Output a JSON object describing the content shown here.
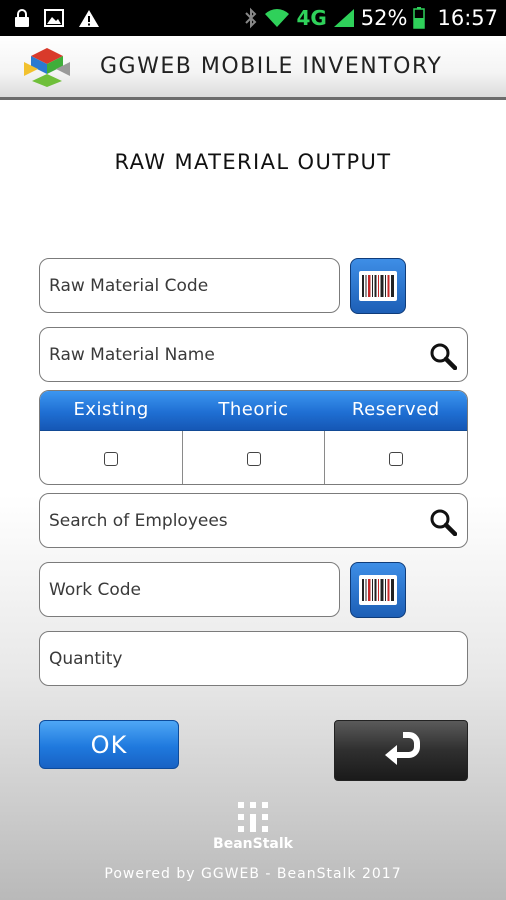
{
  "status_bar": {
    "icons": [
      "lock-icon",
      "image-icon",
      "warning-icon",
      "bluetooth-icon",
      "wifi-icon",
      "signal-icon",
      "battery-icon"
    ],
    "network": "4G",
    "battery": "52%",
    "time": "16:57"
  },
  "header": {
    "app_title": "GGWEB MOBILE INVENTORY"
  },
  "page": {
    "title": "RAW MATERIAL OUTPUT"
  },
  "form": {
    "raw_material_code_placeholder": "Raw Material Code",
    "raw_material_name_placeholder": "Raw Material Name",
    "stock_headers": [
      "Existing",
      "Theoric",
      "Reserved"
    ],
    "employees_placeholder": "Search of Employees",
    "work_code_placeholder": "Work Code",
    "quantity_placeholder": "Quantity"
  },
  "actions": {
    "ok_label": "OK"
  },
  "footer": {
    "brand": "BeanStalk",
    "powered_by": "Powered by GGWEB - BeanStalk 2017"
  },
  "colors": {
    "accent_blue": "#1f6fd3",
    "status_green": "#2fd15a",
    "dark_button": "#2f2f2f"
  }
}
